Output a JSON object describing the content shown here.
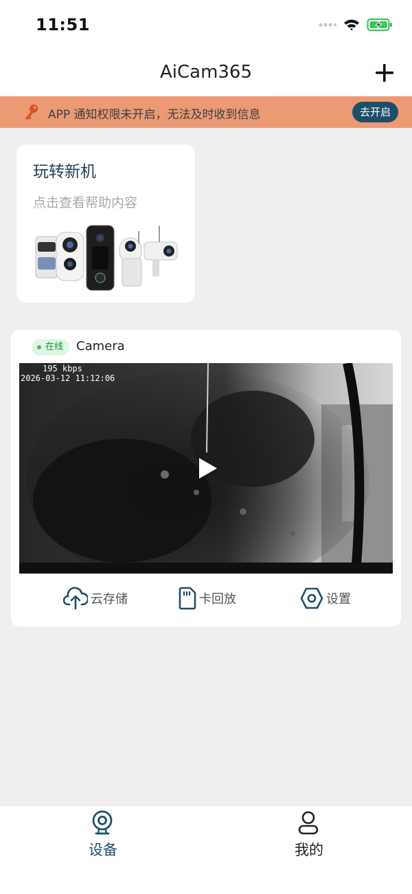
{
  "status_bar": {
    "time": "11:51"
  },
  "nav": {
    "title": "AiCam365"
  },
  "banner": {
    "text": "APP 通知权限未开启，无法及时收到信息",
    "button_label": "去开启"
  },
  "guide_card": {
    "title": "玩转新机",
    "subtitle": "点击查看帮助内容"
  },
  "device": {
    "status": "在线",
    "name": "Camera",
    "bitrate": "195 kbps",
    "timestamp": "2026-03-12 11:12:06",
    "actions": [
      {
        "label": "云存储",
        "icon": "cloud-upload-icon"
      },
      {
        "label": "卡回放",
        "icon": "sd-card-icon"
      },
      {
        "label": "设置",
        "icon": "hex-settings-icon"
      }
    ]
  },
  "tabs": [
    {
      "label": "设备",
      "icon": "camera-icon",
      "active": true
    },
    {
      "label": "我的",
      "icon": "user-icon",
      "active": false
    }
  ],
  "colors": {
    "accent": "#1f4e6b",
    "banner_bg": "#eb9a74",
    "online_bg": "#ddf7e4",
    "online_text": "#1f8a3c",
    "battery": "#34c759"
  }
}
